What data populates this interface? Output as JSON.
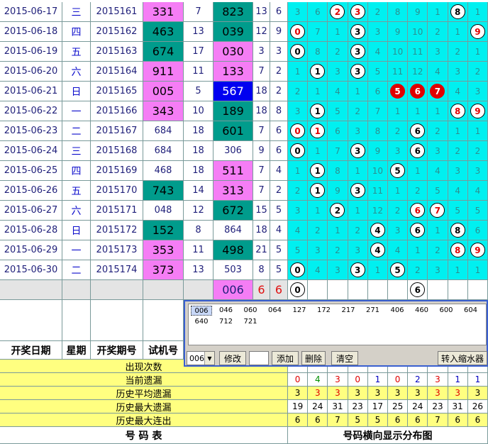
{
  "rows": [
    {
      "date": "2015-06-17",
      "week": "三",
      "issue": "2015161",
      "test": "331",
      "span": "7",
      "draw": "823",
      "sum": "13",
      "k": "6",
      "dist": [
        "3",
        "6",
        "b2r",
        "b3r",
        "2",
        "8",
        "9",
        "1",
        "b8",
        "1"
      ]
    },
    {
      "date": "2015-06-18",
      "week": "四",
      "issue": "2015162",
      "test": "463",
      "span": "13",
      "draw": "039",
      "sum": "12",
      "k": "9",
      "dist": [
        "b0r",
        "7",
        "1",
        "b3",
        "3",
        "9",
        "10",
        "2",
        "1",
        "b9r"
      ]
    },
    {
      "date": "2015-06-19",
      "week": "五",
      "issue": "2015163",
      "test": "674",
      "span": "17",
      "draw": "030",
      "sum": "3",
      "k": "3",
      "dist": [
        "b0",
        "8",
        "2",
        "b3",
        "4",
        "10",
        "11",
        "3",
        "2",
        "1"
      ]
    },
    {
      "date": "2015-06-20",
      "week": "六",
      "issue": "2015164",
      "test": "911",
      "span": "11",
      "draw": "133",
      "sum": "7",
      "k": "2",
      "dist": [
        "1",
        "b1",
        "3",
        "b3",
        "5",
        "11",
        "12",
        "4",
        "3",
        "2"
      ]
    },
    {
      "date": "2015-06-21",
      "week": "日",
      "issue": "2015165",
      "test": "005",
      "span": "5",
      "draw": "567",
      "sum": "18",
      "k": "2",
      "dist": [
        "2",
        "1",
        "4",
        "1",
        "6",
        "f5",
        "f6",
        "f7",
        "4",
        "3"
      ]
    },
    {
      "date": "2015-06-22",
      "week": "一",
      "issue": "2015166",
      "test": "343",
      "span": "10",
      "draw": "189",
      "sum": "18",
      "k": "8",
      "dist": [
        "3",
        "b1",
        "5",
        "2",
        "7",
        "1",
        "1",
        "1",
        "b8r",
        "b9r"
      ]
    },
    {
      "date": "2015-06-23",
      "week": "二",
      "issue": "2015167",
      "test": "684",
      "span": "18",
      "draw": "601",
      "sum": "7",
      "k": "6",
      "dist": [
        "b0r",
        "b1r",
        "6",
        "3",
        "8",
        "2",
        "b6",
        "2",
        "1",
        "1"
      ]
    },
    {
      "date": "2015-06-24",
      "week": "三",
      "issue": "2015168",
      "test": "684",
      "span": "18",
      "draw": "306",
      "sum": "9",
      "k": "6",
      "dist": [
        "b0",
        "1",
        "7",
        "b3",
        "9",
        "3",
        "b6",
        "3",
        "2",
        "2"
      ]
    },
    {
      "date": "2015-06-25",
      "week": "四",
      "issue": "2015169",
      "test": "468",
      "span": "18",
      "draw": "511",
      "sum": "7",
      "k": "4",
      "dist": [
        "1",
        "b1",
        "8",
        "1",
        "10",
        "b5",
        "1",
        "4",
        "3",
        "3"
      ]
    },
    {
      "date": "2015-06-26",
      "week": "五",
      "issue": "2015170",
      "test": "743",
      "span": "14",
      "draw": "313",
      "sum": "7",
      "k": "2",
      "dist": [
        "2",
        "b1",
        "9",
        "b3",
        "11",
        "1",
        "2",
        "5",
        "4",
        "4"
      ]
    },
    {
      "date": "2015-06-27",
      "week": "六",
      "issue": "2015171",
      "test": "048",
      "span": "12",
      "draw": "672",
      "sum": "15",
      "k": "5",
      "dist": [
        "3",
        "1",
        "b2",
        "1",
        "12",
        "2",
        "b6r",
        "b7r",
        "5",
        "5"
      ]
    },
    {
      "date": "2015-06-28",
      "week": "日",
      "issue": "2015172",
      "test": "152",
      "span": "8",
      "draw": "864",
      "sum": "18",
      "k": "4",
      "dist": [
        "4",
        "2",
        "1",
        "2",
        "b4",
        "3",
        "b6",
        "1",
        "b8",
        "6"
      ]
    },
    {
      "date": "2015-06-29",
      "week": "一",
      "issue": "2015173",
      "test": "353",
      "span": "11",
      "draw": "498",
      "sum": "21",
      "k": "5",
      "dist": [
        "5",
        "3",
        "2",
        "3",
        "b4",
        "4",
        "1",
        "2",
        "b8r",
        "b9r"
      ]
    },
    {
      "date": "2015-06-30",
      "week": "二",
      "issue": "2015174",
      "test": "373",
      "span": "13",
      "draw": "503",
      "sum": "8",
      "k": "5",
      "dist": [
        "b0",
        "4",
        "3",
        "b3",
        "1",
        "b5",
        "2",
        "3",
        "1",
        "1"
      ]
    }
  ],
  "forecast": {
    "draw": "006",
    "sum": "6",
    "k": "6",
    "balls": [
      "0",
      "",
      "",
      "",
      "",
      "",
      "6",
      "",
      "",
      ""
    ]
  },
  "colors": {
    "pink": "#f57df5",
    "teal": "#009c8c",
    "blue": "#0000f0",
    "cyan": "#00f0f0",
    "red": "#e00000",
    "yellow": "#ffff80"
  },
  "panel": {
    "items": [
      "006",
      "046",
      "060",
      "064",
      "127",
      "172",
      "217",
      "271",
      "406",
      "460",
      "600",
      "604",
      "640",
      "712",
      "721"
    ],
    "combo": "006",
    "edit_label": "修改",
    "add_label": "添加",
    "delete_label": "删除",
    "clear_label": "清空",
    "shrink_label": "转入缩水器",
    "dropdown_icon": "chevron-down-icon"
  },
  "headers": {
    "date": "开奖日期",
    "week": "星期",
    "issue": "开奖期号",
    "test": "试机号"
  },
  "stats": [
    {
      "label": "出现次数",
      "values": [
        "",
        "",
        "",
        "",
        "",
        "",
        "",
        "",
        "",
        ""
      ]
    },
    {
      "label": "当前遗漏",
      "values": [
        "0",
        "4",
        "3",
        "0",
        "1",
        "0",
        "2",
        "3",
        "1",
        "1"
      ]
    },
    {
      "label": "历史平均遗漏",
      "values": [
        "3",
        "3",
        "3",
        "3",
        "3",
        "3",
        "3",
        "3",
        "3",
        "3"
      ]
    },
    {
      "label": "历史最大遗漏",
      "values": [
        "19",
        "24",
        "31",
        "23",
        "17",
        "25",
        "24",
        "23",
        "31",
        "26"
      ]
    },
    {
      "label": "历史最大连出",
      "values": [
        "6",
        "6",
        "7",
        "5",
        "5",
        "6",
        "6",
        "7",
        "6",
        "6"
      ]
    }
  ],
  "footer": {
    "left": "号  码  表",
    "right": "号码横向显示分布图"
  }
}
